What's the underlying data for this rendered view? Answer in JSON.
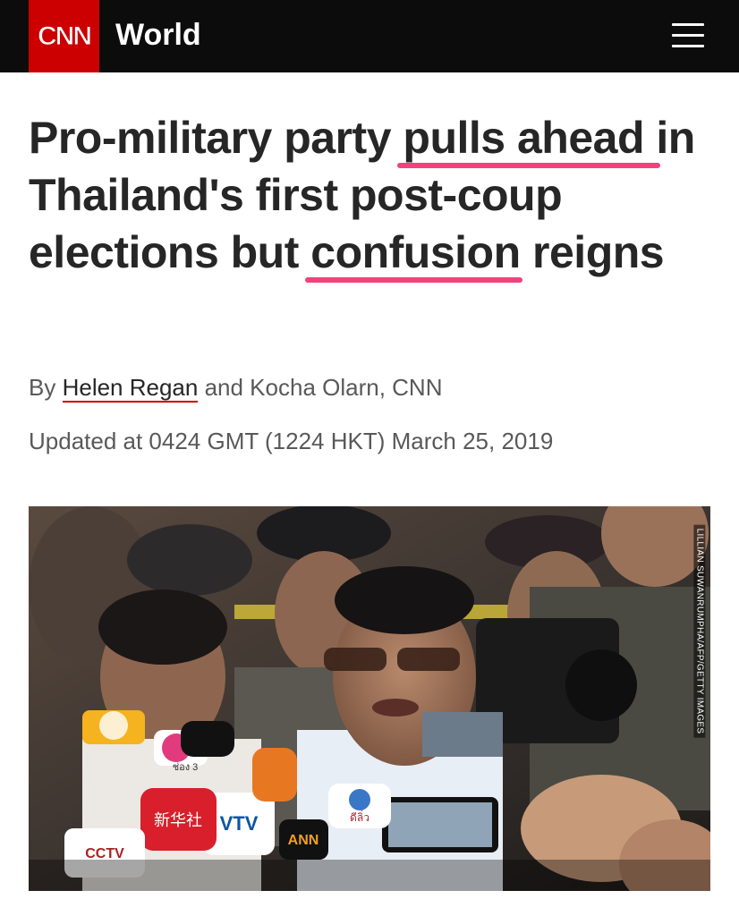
{
  "header": {
    "logo_text": "CNN",
    "section_title": "World",
    "menu_icon": "hamburger-icon",
    "background_color": "#0c0c0c",
    "logo_color": "#cc0000"
  },
  "article": {
    "headline_parts": {
      "part1": "Pro-military party ",
      "highlight1": "pulls ahead",
      "part2": " in Thailand's first post-coup elections but ",
      "highlight2": "confusion",
      "part3": " reigns"
    },
    "highlight_color": "#f0437b",
    "byline": {
      "prefix": "By ",
      "author_link": "Helen Regan",
      "suffix": " and Kocha Olarn, CNN"
    },
    "updated": "Updated at 0424 GMT (1224 HKT) March 25, 2019",
    "photo": {
      "credit": "LILLIAN SUWANRUMPHA/AFP/GETTY IMAGES",
      "mic_labels": [
        "VTV",
        "CCTV",
        "ANN",
        "ช่อง 3",
        "ดีลิ่ว",
        "新华社"
      ]
    }
  }
}
